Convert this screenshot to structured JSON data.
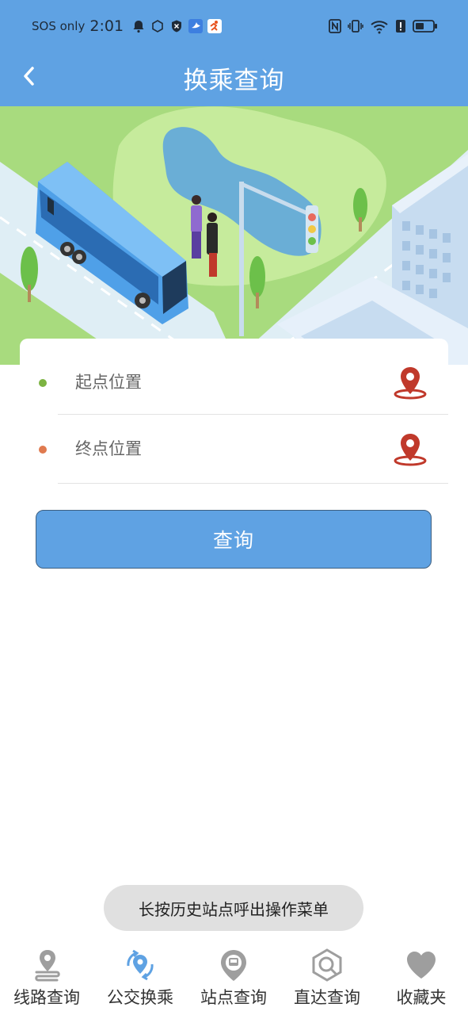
{
  "status_bar": {
    "carrier": "SOS only",
    "time": "2:01"
  },
  "header": {
    "title": "换乘查询",
    "back_icon": "chevron-left-icon"
  },
  "form": {
    "start_placeholder": "起点位置",
    "end_placeholder": "终点位置",
    "start_dot_color": "#7cb342",
    "end_dot_color": "#e07a4f",
    "pin_icon": "location-pin-icon",
    "pin_color": "#c0392b"
  },
  "query_button": {
    "label": "查询"
  },
  "toast": {
    "text": "长按历史站点呼出操作菜单"
  },
  "colors": {
    "primary": "#5fa2e3",
    "inactive_icon": "#9e9e9e"
  },
  "bottom_nav": {
    "items": [
      {
        "label": "线路查询",
        "icon": "route-icon",
        "active": false
      },
      {
        "label": "公交换乘",
        "icon": "transfer-icon",
        "active": true
      },
      {
        "label": "站点查询",
        "icon": "station-icon",
        "active": false
      },
      {
        "label": "直达查询",
        "icon": "direct-search-icon",
        "active": false
      },
      {
        "label": "收藏夹",
        "icon": "heart-icon",
        "active": false
      }
    ]
  }
}
